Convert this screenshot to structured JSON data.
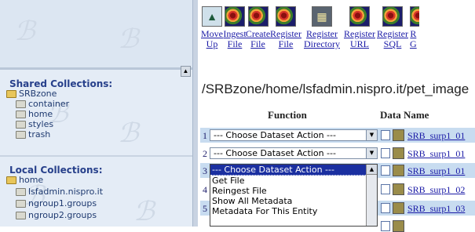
{
  "left_panel": {
    "shared": {
      "heading": "Shared Collections:",
      "root": "SRBzone",
      "children": [
        "container",
        "home",
        "styles",
        "trash"
      ]
    },
    "local": {
      "heading": "Local Collections:",
      "root": "home",
      "children": [
        "lsfadmin.nispro.it",
        "ngroup1.groups",
        "ngroup2.groups"
      ]
    }
  },
  "toolbar": {
    "buttons": [
      {
        "label": "Move\nUp",
        "icon": "arrow-up-icon"
      },
      {
        "label": "Ingest\nFile",
        "icon": "srb-swirl-icon"
      },
      {
        "label": "Create\nFile",
        "icon": "srb-swirl-icon"
      },
      {
        "label": "Register\nFile",
        "icon": "srb-swirl-icon"
      },
      {
        "label": "Register\nDirectory",
        "icon": "directory-icon"
      },
      {
        "label": "Register\nURL",
        "icon": "srb-swirl-icon"
      },
      {
        "label": "Register\nSQL",
        "icon": "srb-swirl-icon"
      },
      {
        "label": "R\nG",
        "icon": "srb-swirl-icon"
      }
    ]
  },
  "path": "/SRBzone/home/lsfadmin.nispro.it/pet_image",
  "table": {
    "col_function": "Function",
    "col_dataname": "Data Name",
    "rows": [
      {
        "num": "1",
        "action": "--- Choose Dataset Action ---",
        "name": "SRB_surp1_01"
      },
      {
        "num": "2",
        "action": "--- Choose Dataset Action ---",
        "name": "SRB_surp1_01"
      },
      {
        "num": "3",
        "action": "",
        "name": "SRB_surp1_01"
      },
      {
        "num": "4",
        "action": "",
        "name": "SRB_surp1_02"
      },
      {
        "num": "5",
        "action": "",
        "name": "SRB_surp1_03"
      }
    ]
  },
  "dropdown": {
    "options": [
      "--- Choose Dataset Action ---",
      "Get File",
      "Reingest File",
      "Show All Metadata",
      "Metadata For This Entity"
    ]
  }
}
